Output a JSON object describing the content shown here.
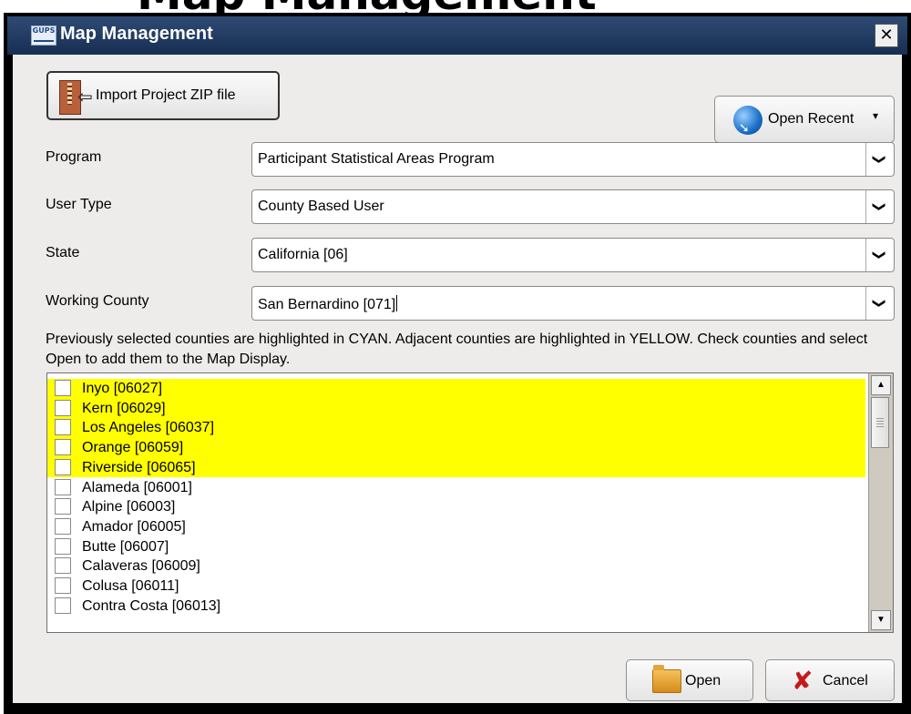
{
  "background_heading": "Map Management",
  "window": {
    "app_icon_text": "GUPS",
    "title": "Map Management",
    "close_glyph": "✕"
  },
  "toolbar": {
    "import_label": "Import Project ZIP file",
    "open_recent_label": "Open Recent",
    "open_recent_caret": "▾"
  },
  "form": {
    "program_label": "Program",
    "program_value": "Participant Statistical Areas Program",
    "user_type_label": "User Type",
    "user_type_value": "County Based User",
    "state_label": "State",
    "state_value": "California [06]",
    "county_label": "Working County",
    "county_value": "San Bernardino [071]",
    "dropdown_glyph": "❯"
  },
  "info_text": "Previously selected counties are highlighted in CYAN. Adjacent counties are highlighted in YELLOW. Check counties and select Open to add them to the Map Display.",
  "counties": [
    {
      "label": "Inyo [06027]",
      "highlight": "yellow",
      "checked": false
    },
    {
      "label": "Kern [06029]",
      "highlight": "yellow",
      "checked": false
    },
    {
      "label": "Los Angeles [06037]",
      "highlight": "yellow",
      "checked": false
    },
    {
      "label": "Orange [06059]",
      "highlight": "yellow",
      "checked": false
    },
    {
      "label": "Riverside [06065]",
      "highlight": "yellow",
      "checked": false
    },
    {
      "label": "Alameda [06001]",
      "highlight": "none",
      "checked": false
    },
    {
      "label": "Alpine [06003]",
      "highlight": "none",
      "checked": false
    },
    {
      "label": "Amador [06005]",
      "highlight": "none",
      "checked": false
    },
    {
      "label": "Butte [06007]",
      "highlight": "none",
      "checked": false
    },
    {
      "label": "Calaveras [06009]",
      "highlight": "none",
      "checked": false
    },
    {
      "label": "Colusa [06011]",
      "highlight": "none",
      "checked": false
    },
    {
      "label": "Contra Costa [06013]",
      "highlight": "none",
      "checked": false
    }
  ],
  "buttons": {
    "open_label": "Open",
    "cancel_label": "Cancel"
  },
  "colors": {
    "titlebar": "#213a63",
    "adjacent_highlight": "#ffff00",
    "dialog_bg": "#edeceb"
  }
}
